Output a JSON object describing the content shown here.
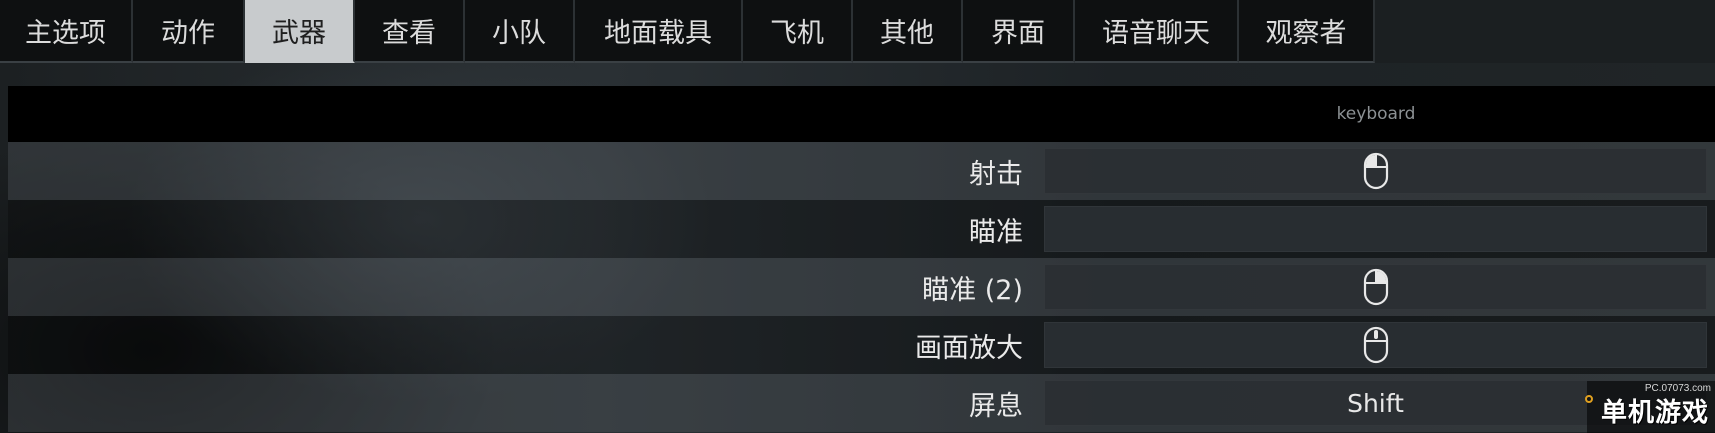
{
  "tabs": [
    {
      "label": "主选项",
      "active": false
    },
    {
      "label": "动作",
      "active": false
    },
    {
      "label": "武器",
      "active": true
    },
    {
      "label": "查看",
      "active": false
    },
    {
      "label": "小队",
      "active": false
    },
    {
      "label": "地面载具",
      "active": false
    },
    {
      "label": "飞机",
      "active": false
    },
    {
      "label": "其他",
      "active": false
    },
    {
      "label": "界面",
      "active": false
    },
    {
      "label": "语音聊天",
      "active": false
    },
    {
      "label": "观察者",
      "active": false
    }
  ],
  "table": {
    "device_header": "keyboard",
    "rows": [
      {
        "label": "射击",
        "binding_icon": "mouse-left-icon",
        "binding_text": ""
      },
      {
        "label": "瞄准",
        "binding_icon": "",
        "binding_text": ""
      },
      {
        "label": "瞄准 (2)",
        "binding_icon": "mouse-right-icon",
        "binding_text": ""
      },
      {
        "label": "画面放大",
        "binding_icon": "mouse-middle-icon",
        "binding_text": ""
      },
      {
        "label": "屏息",
        "binding_icon": "",
        "binding_text": "Shift"
      }
    ]
  },
  "watermark": {
    "url": "PC.07073.com",
    "logo": "单机游戏"
  },
  "colors": {
    "tab_active_bg": "#c8cbcd",
    "tab_bg": "#0e1011",
    "header_bg": "#000000",
    "cell_bg": "#2a2f33"
  }
}
